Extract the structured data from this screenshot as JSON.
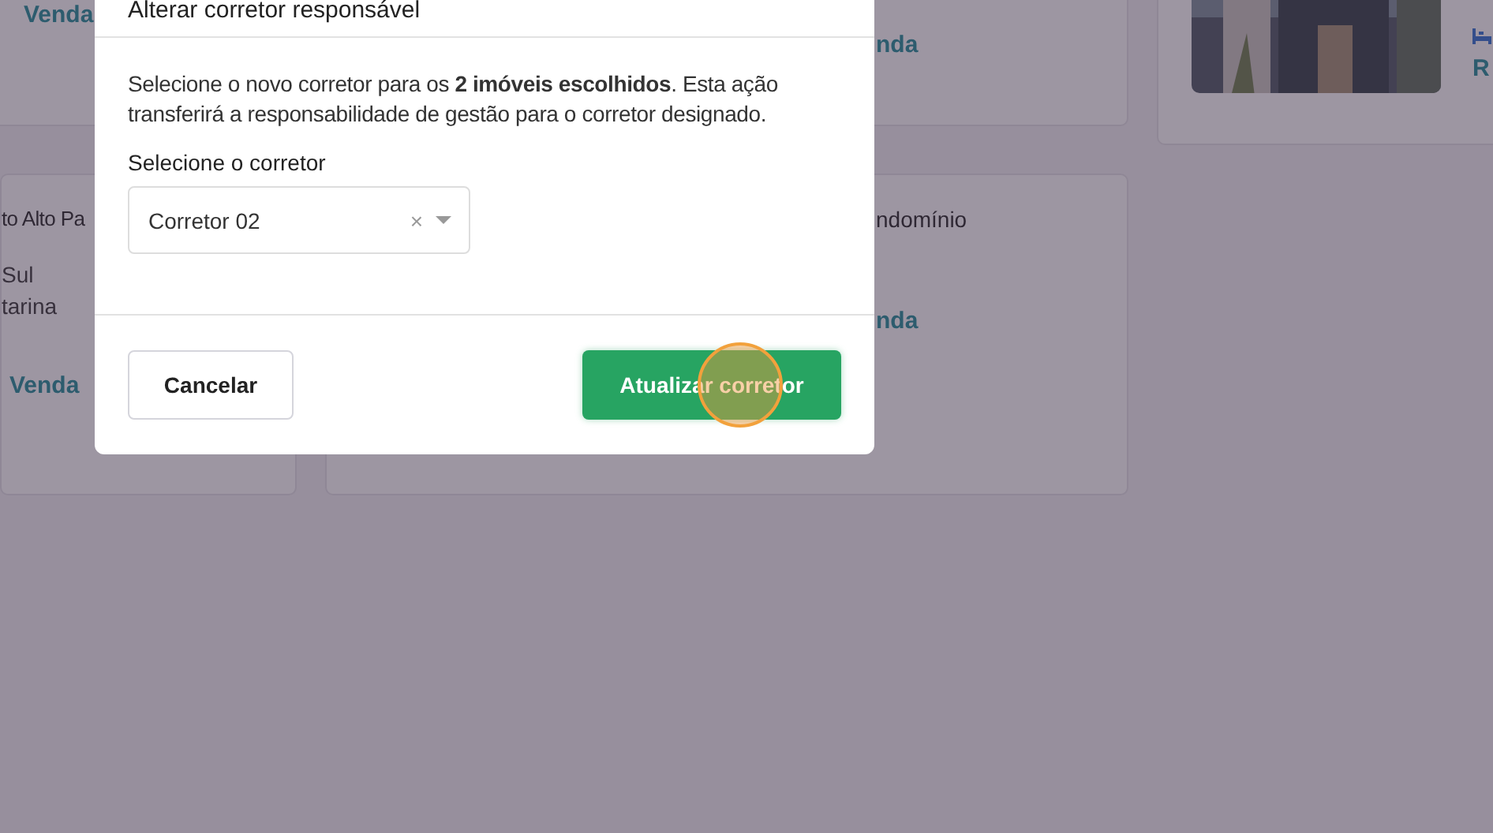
{
  "listing_cards": [
    {
      "lines": [
        {
          "kind": "deal",
          "text": "Venda"
        }
      ]
    },
    {
      "lines": [
        {
          "kind": "deal",
          "text": "nda"
        }
      ]
    },
    {
      "lines": [
        {
          "kind": "feature"
        },
        {
          "kind": "deal",
          "text": "R"
        }
      ]
    },
    {
      "lines": [
        {
          "kind": "title",
          "text": "to Alto Pa"
        },
        {
          "kind": "detail",
          "text": "Sul"
        },
        {
          "kind": "detail",
          "text": "tarina"
        },
        {
          "kind": "deal",
          "text": "Venda"
        }
      ]
    },
    {
      "lines": [
        {
          "kind": "title",
          "text": "ndomínio"
        },
        {
          "kind": "deal",
          "text": "nda"
        }
      ]
    }
  ],
  "dialog": {
    "title": "Alterar corretor responsável",
    "message": "Selecione o novo corretor para os **2 imóveis escolhidos**. Esta ação transferirá a responsabilidade de gestão para o corretor designado.",
    "field_label": "Selecione o corretor",
    "select": {
      "value": "Corretor 02",
      "clear": "×"
    },
    "buttons": [
      {
        "kind": "secondary",
        "label": "Cancelar"
      },
      {
        "kind": "primary",
        "label": "Atualizar corretor"
      }
    ]
  }
}
